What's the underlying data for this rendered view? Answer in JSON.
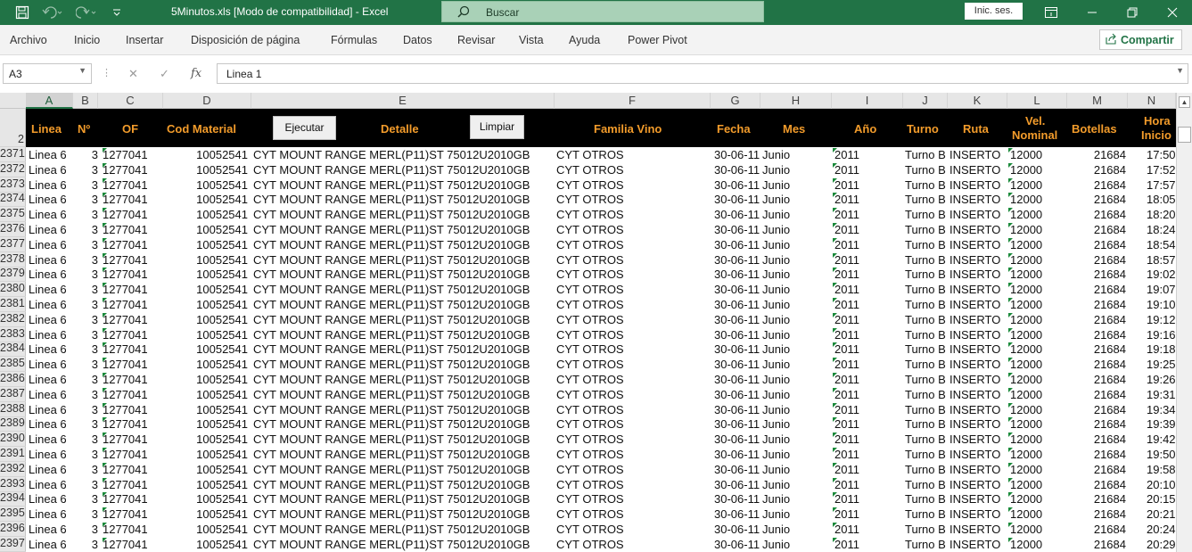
{
  "titlebar": {
    "title": "5Minutos.xls  [Modo de compatibilidad]  -  Excel",
    "search_label": "Buscar",
    "signin_label": "Inic. ses.",
    "accent": "#217346"
  },
  "ribbon": {
    "tabs": [
      "Archivo",
      "Inicio",
      "Insertar",
      "Disposición de página",
      "Fórmulas",
      "Datos",
      "Revisar",
      "Vista",
      "Ayuda",
      "Power Pivot"
    ],
    "share_label": "Compartir"
  },
  "formula_bar": {
    "cell_ref": "A3",
    "content": "Linea 1"
  },
  "columns": [
    "A",
    "B",
    "C",
    "D",
    "E",
    "F",
    "G",
    "H",
    "I",
    "J",
    "K",
    "L",
    "M",
    "N"
  ],
  "selected_column": "A",
  "header_row_number": "2",
  "header": {
    "linea": "Linea",
    "no": "Nº",
    "of": "OF",
    "cod_material": "Cod Material",
    "ejecutar_button": "Ejecutar",
    "detalle": "Detalle",
    "limpiar_button": "Limpiar",
    "familia_vino": "Familia Vino",
    "fecha": "Fecha",
    "mes": "Mes",
    "anio": "Año",
    "turno": "Turno",
    "ruta": "Ruta",
    "vel_nominal_1": "Vel.",
    "vel_nominal_2": "Nominal",
    "botellas": "Botellas",
    "hora_inicio_1": "Hora",
    "hora_inicio_2": "Inicio",
    "header_color": "#f39c2b"
  },
  "rows": [
    {
      "row": "2371",
      "linea": "Linea 6",
      "no": "3",
      "of": "1277041",
      "cod": "10052541",
      "detalle": "CYT MOUNT RANGE MERL(P11)ST 75012U2010GB",
      "familia": "CYT OTROS",
      "fecha": "30-06-11",
      "mes": "Junio",
      "anio": "2011",
      "turno": "Turno B",
      "ruta": "INSERTO",
      "vel": "12000",
      "botellas": "21684",
      "hora": "17:50"
    },
    {
      "row": "2372",
      "linea": "Linea 6",
      "no": "3",
      "of": "1277041",
      "cod": "10052541",
      "detalle": "CYT MOUNT RANGE MERL(P11)ST 75012U2010GB",
      "familia": "CYT OTROS",
      "fecha": "30-06-11",
      "mes": "Junio",
      "anio": "2011",
      "turno": "Turno B",
      "ruta": "INSERTO",
      "vel": "12000",
      "botellas": "21684",
      "hora": "17:52"
    },
    {
      "row": "2373",
      "linea": "Linea 6",
      "no": "3",
      "of": "1277041",
      "cod": "10052541",
      "detalle": "CYT MOUNT RANGE MERL(P11)ST 75012U2010GB",
      "familia": "CYT OTROS",
      "fecha": "30-06-11",
      "mes": "Junio",
      "anio": "2011",
      "turno": "Turno B",
      "ruta": "INSERTO",
      "vel": "12000",
      "botellas": "21684",
      "hora": "17:57"
    },
    {
      "row": "2374",
      "linea": "Linea 6",
      "no": "3",
      "of": "1277041",
      "cod": "10052541",
      "detalle": "CYT MOUNT RANGE MERL(P11)ST 75012U2010GB",
      "familia": "CYT OTROS",
      "fecha": "30-06-11",
      "mes": "Junio",
      "anio": "2011",
      "turno": "Turno B",
      "ruta": "INSERTO",
      "vel": "12000",
      "botellas": "21684",
      "hora": "18:05"
    },
    {
      "row": "2375",
      "linea": "Linea 6",
      "no": "3",
      "of": "1277041",
      "cod": "10052541",
      "detalle": "CYT MOUNT RANGE MERL(P11)ST 75012U2010GB",
      "familia": "CYT OTROS",
      "fecha": "30-06-11",
      "mes": "Junio",
      "anio": "2011",
      "turno": "Turno B",
      "ruta": "INSERTO",
      "vel": "12000",
      "botellas": "21684",
      "hora": "18:20"
    },
    {
      "row": "2376",
      "linea": "Linea 6",
      "no": "3",
      "of": "1277041",
      "cod": "10052541",
      "detalle": "CYT MOUNT RANGE MERL(P11)ST 75012U2010GB",
      "familia": "CYT OTROS",
      "fecha": "30-06-11",
      "mes": "Junio",
      "anio": "2011",
      "turno": "Turno B",
      "ruta": "INSERTO",
      "vel": "12000",
      "botellas": "21684",
      "hora": "18:24"
    },
    {
      "row": "2377",
      "linea": "Linea 6",
      "no": "3",
      "of": "1277041",
      "cod": "10052541",
      "detalle": "CYT MOUNT RANGE MERL(P11)ST 75012U2010GB",
      "familia": "CYT OTROS",
      "fecha": "30-06-11",
      "mes": "Junio",
      "anio": "2011",
      "turno": "Turno B",
      "ruta": "INSERTO",
      "vel": "12000",
      "botellas": "21684",
      "hora": "18:54"
    },
    {
      "row": "2378",
      "linea": "Linea 6",
      "no": "3",
      "of": "1277041",
      "cod": "10052541",
      "detalle": "CYT MOUNT RANGE MERL(P11)ST 75012U2010GB",
      "familia": "CYT OTROS",
      "fecha": "30-06-11",
      "mes": "Junio",
      "anio": "2011",
      "turno": "Turno B",
      "ruta": "INSERTO",
      "vel": "12000",
      "botellas": "21684",
      "hora": "18:57"
    },
    {
      "row": "2379",
      "linea": "Linea 6",
      "no": "3",
      "of": "1277041",
      "cod": "10052541",
      "detalle": "CYT MOUNT RANGE MERL(P11)ST 75012U2010GB",
      "familia": "CYT OTROS",
      "fecha": "30-06-11",
      "mes": "Junio",
      "anio": "2011",
      "turno": "Turno B",
      "ruta": "INSERTO",
      "vel": "12000",
      "botellas": "21684",
      "hora": "19:02"
    },
    {
      "row": "2380",
      "linea": "Linea 6",
      "no": "3",
      "of": "1277041",
      "cod": "10052541",
      "detalle": "CYT MOUNT RANGE MERL(P11)ST 75012U2010GB",
      "familia": "CYT OTROS",
      "fecha": "30-06-11",
      "mes": "Junio",
      "anio": "2011",
      "turno": "Turno B",
      "ruta": "INSERTO",
      "vel": "12000",
      "botellas": "21684",
      "hora": "19:07"
    },
    {
      "row": "2381",
      "linea": "Linea 6",
      "no": "3",
      "of": "1277041",
      "cod": "10052541",
      "detalle": "CYT MOUNT RANGE MERL(P11)ST 75012U2010GB",
      "familia": "CYT OTROS",
      "fecha": "30-06-11",
      "mes": "Junio",
      "anio": "2011",
      "turno": "Turno B",
      "ruta": "INSERTO",
      "vel": "12000",
      "botellas": "21684",
      "hora": "19:10"
    },
    {
      "row": "2382",
      "linea": "Linea 6",
      "no": "3",
      "of": "1277041",
      "cod": "10052541",
      "detalle": "CYT MOUNT RANGE MERL(P11)ST 75012U2010GB",
      "familia": "CYT OTROS",
      "fecha": "30-06-11",
      "mes": "Junio",
      "anio": "2011",
      "turno": "Turno B",
      "ruta": "INSERTO",
      "vel": "12000",
      "botellas": "21684",
      "hora": "19:12"
    },
    {
      "row": "2383",
      "linea": "Linea 6",
      "no": "3",
      "of": "1277041",
      "cod": "10052541",
      "detalle": "CYT MOUNT RANGE MERL(P11)ST 75012U2010GB",
      "familia": "CYT OTROS",
      "fecha": "30-06-11",
      "mes": "Junio",
      "anio": "2011",
      "turno": "Turno B",
      "ruta": "INSERTO",
      "vel": "12000",
      "botellas": "21684",
      "hora": "19:16"
    },
    {
      "row": "2384",
      "linea": "Linea 6",
      "no": "3",
      "of": "1277041",
      "cod": "10052541",
      "detalle": "CYT MOUNT RANGE MERL(P11)ST 75012U2010GB",
      "familia": "CYT OTROS",
      "fecha": "30-06-11",
      "mes": "Junio",
      "anio": "2011",
      "turno": "Turno B",
      "ruta": "INSERTO",
      "vel": "12000",
      "botellas": "21684",
      "hora": "19:18"
    },
    {
      "row": "2385",
      "linea": "Linea 6",
      "no": "3",
      "of": "1277041",
      "cod": "10052541",
      "detalle": "CYT MOUNT RANGE MERL(P11)ST 75012U2010GB",
      "familia": "CYT OTROS",
      "fecha": "30-06-11",
      "mes": "Junio",
      "anio": "2011",
      "turno": "Turno B",
      "ruta": "INSERTO",
      "vel": "12000",
      "botellas": "21684",
      "hora": "19:25"
    },
    {
      "row": "2386",
      "linea": "Linea 6",
      "no": "3",
      "of": "1277041",
      "cod": "10052541",
      "detalle": "CYT MOUNT RANGE MERL(P11)ST 75012U2010GB",
      "familia": "CYT OTROS",
      "fecha": "30-06-11",
      "mes": "Junio",
      "anio": "2011",
      "turno": "Turno B",
      "ruta": "INSERTO",
      "vel": "12000",
      "botellas": "21684",
      "hora": "19:26"
    },
    {
      "row": "2387",
      "linea": "Linea 6",
      "no": "3",
      "of": "1277041",
      "cod": "10052541",
      "detalle": "CYT MOUNT RANGE MERL(P11)ST 75012U2010GB",
      "familia": "CYT OTROS",
      "fecha": "30-06-11",
      "mes": "Junio",
      "anio": "2011",
      "turno": "Turno B",
      "ruta": "INSERTO",
      "vel": "12000",
      "botellas": "21684",
      "hora": "19:31"
    },
    {
      "row": "2388",
      "linea": "Linea 6",
      "no": "3",
      "of": "1277041",
      "cod": "10052541",
      "detalle": "CYT MOUNT RANGE MERL(P11)ST 75012U2010GB",
      "familia": "CYT OTROS",
      "fecha": "30-06-11",
      "mes": "Junio",
      "anio": "2011",
      "turno": "Turno B",
      "ruta": "INSERTO",
      "vel": "12000",
      "botellas": "21684",
      "hora": "19:34"
    },
    {
      "row": "2389",
      "linea": "Linea 6",
      "no": "3",
      "of": "1277041",
      "cod": "10052541",
      "detalle": "CYT MOUNT RANGE MERL(P11)ST 75012U2010GB",
      "familia": "CYT OTROS",
      "fecha": "30-06-11",
      "mes": "Junio",
      "anio": "2011",
      "turno": "Turno B",
      "ruta": "INSERTO",
      "vel": "12000",
      "botellas": "21684",
      "hora": "19:39"
    },
    {
      "row": "2390",
      "linea": "Linea 6",
      "no": "3",
      "of": "1277041",
      "cod": "10052541",
      "detalle": "CYT MOUNT RANGE MERL(P11)ST 75012U2010GB",
      "familia": "CYT OTROS",
      "fecha": "30-06-11",
      "mes": "Junio",
      "anio": "2011",
      "turno": "Turno B",
      "ruta": "INSERTO",
      "vel": "12000",
      "botellas": "21684",
      "hora": "19:42"
    },
    {
      "row": "2391",
      "linea": "Linea 6",
      "no": "3",
      "of": "1277041",
      "cod": "10052541",
      "detalle": "CYT MOUNT RANGE MERL(P11)ST 75012U2010GB",
      "familia": "CYT OTROS",
      "fecha": "30-06-11",
      "mes": "Junio",
      "anio": "2011",
      "turno": "Turno B",
      "ruta": "INSERTO",
      "vel": "12000",
      "botellas": "21684",
      "hora": "19:50"
    },
    {
      "row": "2392",
      "linea": "Linea 6",
      "no": "3",
      "of": "1277041",
      "cod": "10052541",
      "detalle": "CYT MOUNT RANGE MERL(P11)ST 75012U2010GB",
      "familia": "CYT OTROS",
      "fecha": "30-06-11",
      "mes": "Junio",
      "anio": "2011",
      "turno": "Turno B",
      "ruta": "INSERTO",
      "vel": "12000",
      "botellas": "21684",
      "hora": "19:58"
    },
    {
      "row": "2393",
      "linea": "Linea 6",
      "no": "3",
      "of": "1277041",
      "cod": "10052541",
      "detalle": "CYT MOUNT RANGE MERL(P11)ST 75012U2010GB",
      "familia": "CYT OTROS",
      "fecha": "30-06-11",
      "mes": "Junio",
      "anio": "2011",
      "turno": "Turno B",
      "ruta": "INSERTO",
      "vel": "12000",
      "botellas": "21684",
      "hora": "20:10"
    },
    {
      "row": "2394",
      "linea": "Linea 6",
      "no": "3",
      "of": "1277041",
      "cod": "10052541",
      "detalle": "CYT MOUNT RANGE MERL(P11)ST 75012U2010GB",
      "familia": "CYT OTROS",
      "fecha": "30-06-11",
      "mes": "Junio",
      "anio": "2011",
      "turno": "Turno B",
      "ruta": "INSERTO",
      "vel": "12000",
      "botellas": "21684",
      "hora": "20:15"
    },
    {
      "row": "2395",
      "linea": "Linea 6",
      "no": "3",
      "of": "1277041",
      "cod": "10052541",
      "detalle": "CYT MOUNT RANGE MERL(P11)ST 75012U2010GB",
      "familia": "CYT OTROS",
      "fecha": "30-06-11",
      "mes": "Junio",
      "anio": "2011",
      "turno": "Turno B",
      "ruta": "INSERTO",
      "vel": "12000",
      "botellas": "21684",
      "hora": "20:21"
    },
    {
      "row": "2396",
      "linea": "Linea 6",
      "no": "3",
      "of": "1277041",
      "cod": "10052541",
      "detalle": "CYT MOUNT RANGE MERL(P11)ST 75012U2010GB",
      "familia": "CYT OTROS",
      "fecha": "30-06-11",
      "mes": "Junio",
      "anio": "2011",
      "turno": "Turno B",
      "ruta": "INSERTO",
      "vel": "12000",
      "botellas": "21684",
      "hora": "20:24"
    },
    {
      "row": "2397",
      "linea": "Linea 6",
      "no": "3",
      "of": "1277041",
      "cod": "10052541",
      "detalle": "CYT MOUNT RANGE MERL(P11)ST 75012U2010GB",
      "familia": "CYT OTROS",
      "fecha": "30-06-11",
      "mes": "Junio",
      "anio": "2011",
      "turno": "Turno B",
      "ruta": "INSERTO",
      "vel": "12000",
      "botellas": "21684",
      "hora": "20:29"
    }
  ]
}
